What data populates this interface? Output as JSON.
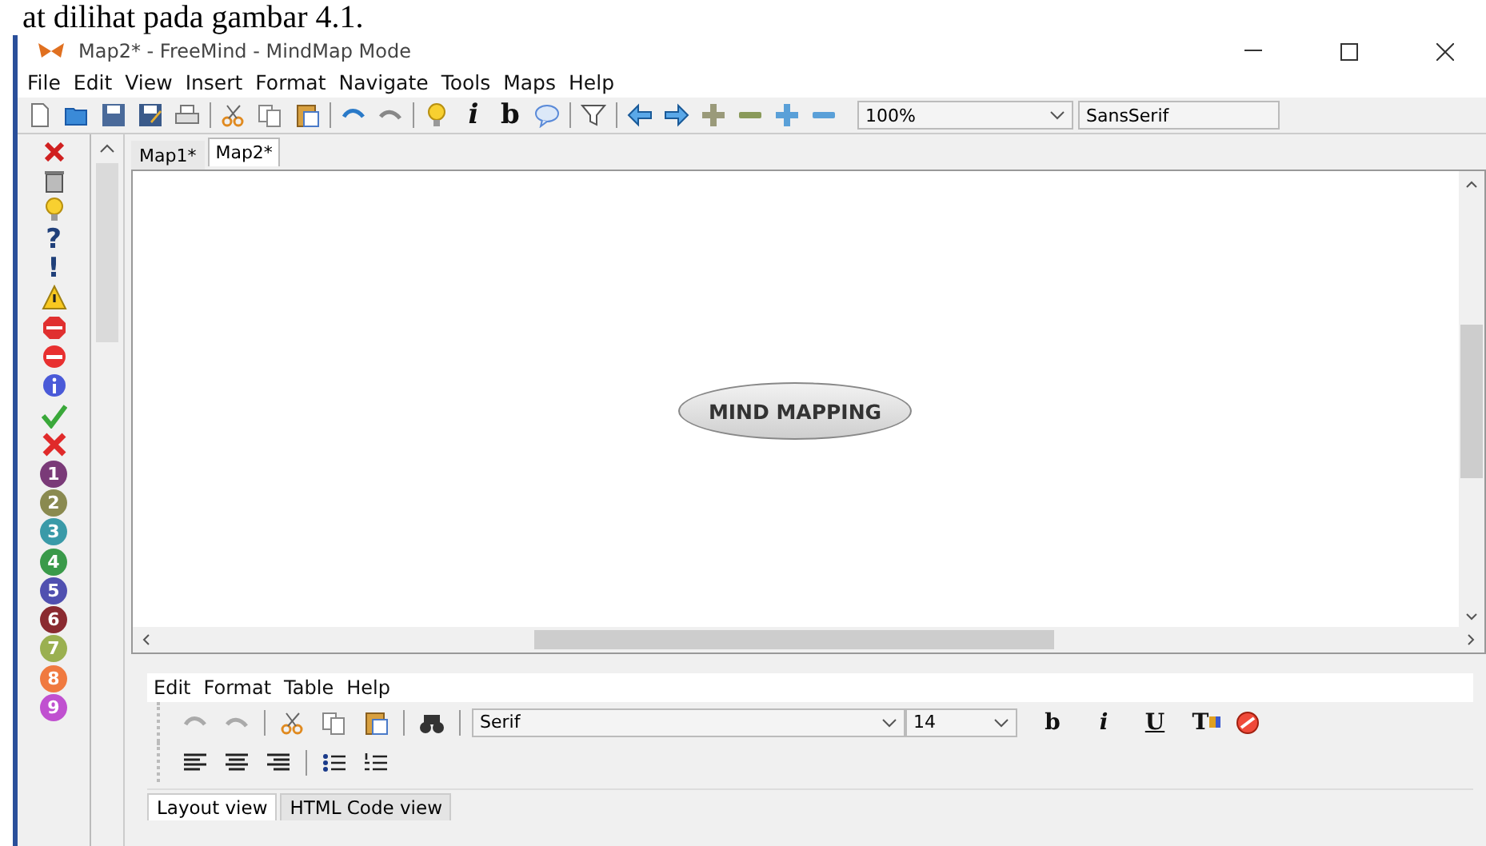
{
  "document_text": "at dilihat pada gambar 4.1.",
  "window": {
    "title": "Map2* - FreeMind - MindMap Mode"
  },
  "menu": [
    "File",
    "Edit",
    "View",
    "Insert",
    "Format",
    "Navigate",
    "Tools",
    "Maps",
    "Help"
  ],
  "toolbar": [
    {
      "kind": "new"
    },
    {
      "kind": "open"
    },
    {
      "kind": "save"
    },
    {
      "kind": "saveas"
    },
    {
      "kind": "print"
    },
    {
      "kind": "sep"
    },
    {
      "kind": "cut"
    },
    {
      "kind": "copy"
    },
    {
      "kind": "paste"
    },
    {
      "kind": "sep"
    },
    {
      "kind": "undo"
    },
    {
      "kind": "redo"
    },
    {
      "kind": "sep"
    },
    {
      "kind": "bulb"
    },
    {
      "kind": "italic",
      "text": "i"
    },
    {
      "kind": "bold",
      "text": "b"
    },
    {
      "kind": "cloud"
    },
    {
      "kind": "sep"
    },
    {
      "kind": "filter"
    },
    {
      "kind": "sep"
    },
    {
      "kind": "left"
    },
    {
      "kind": "right"
    },
    {
      "kind": "plus",
      "color": "#9a9a7a"
    },
    {
      "kind": "minus",
      "color": "#8a9a5a"
    },
    {
      "kind": "plus",
      "color": "#5aa0d8"
    },
    {
      "kind": "minus",
      "color": "#5aa0d8"
    }
  ],
  "zoom": {
    "value": "100%"
  },
  "font": {
    "value": "SansSerif"
  },
  "side_icons": [
    {
      "kind": "trash"
    },
    {
      "kind": "bulb"
    },
    {
      "kind": "glyph",
      "text": "?",
      "color": "#20407a"
    },
    {
      "kind": "glyph",
      "text": "!",
      "color": "#20407a"
    },
    {
      "kind": "warning"
    },
    {
      "kind": "stop"
    },
    {
      "kind": "noentry"
    },
    {
      "kind": "info"
    },
    {
      "kind": "check"
    },
    {
      "kind": "cross"
    },
    {
      "kind": "number",
      "text": "1",
      "color": "#7a3a78"
    },
    {
      "kind": "number",
      "text": "2",
      "color": "#8a8a50"
    },
    {
      "kind": "number",
      "text": "3",
      "color": "#3a9aa8"
    },
    {
      "kind": "number",
      "text": "4",
      "color": "#3a9a4a"
    },
    {
      "kind": "number",
      "text": "5",
      "color": "#5050b0"
    },
    {
      "kind": "number",
      "text": "6",
      "color": "#8a2a30"
    },
    {
      "kind": "number",
      "text": "7",
      "color": "#9ab050"
    },
    {
      "kind": "number",
      "text": "8",
      "color": "#f07a40"
    },
    {
      "kind": "number",
      "text": "9",
      "color": "#c050d0"
    }
  ],
  "tabs": [
    {
      "label": "Map1*",
      "selected": false
    },
    {
      "label": "Map2*",
      "selected": true
    }
  ],
  "node": {
    "text": "MIND MAPPING"
  },
  "editor": {
    "menu": [
      "Edit",
      "Format",
      "Table",
      "Help"
    ],
    "toolbar1": [
      {
        "kind": "undo"
      },
      {
        "kind": "redo"
      },
      {
        "kind": "sep"
      },
      {
        "kind": "cut"
      },
      {
        "kind": "copy"
      },
      {
        "kind": "paste"
      },
      {
        "kind": "sep"
      },
      {
        "kind": "find"
      },
      {
        "kind": "sep"
      }
    ],
    "font": "Serif",
    "size": "14",
    "format": [
      {
        "kind": "bold",
        "text": "b"
      },
      {
        "kind": "italic",
        "text": "i"
      },
      {
        "kind": "underline",
        "text": "U"
      },
      {
        "kind": "color",
        "text": "T"
      },
      {
        "kind": "clear"
      }
    ],
    "toolbar2": [
      {
        "kind": "align-left"
      },
      {
        "kind": "align-center"
      },
      {
        "kind": "align-right"
      },
      {
        "kind": "sep"
      },
      {
        "kind": "bullets"
      },
      {
        "kind": "numbers"
      }
    ],
    "tabs": [
      {
        "label": "Layout view",
        "selected": true
      },
      {
        "label": "HTML Code view",
        "selected": false
      }
    ]
  }
}
